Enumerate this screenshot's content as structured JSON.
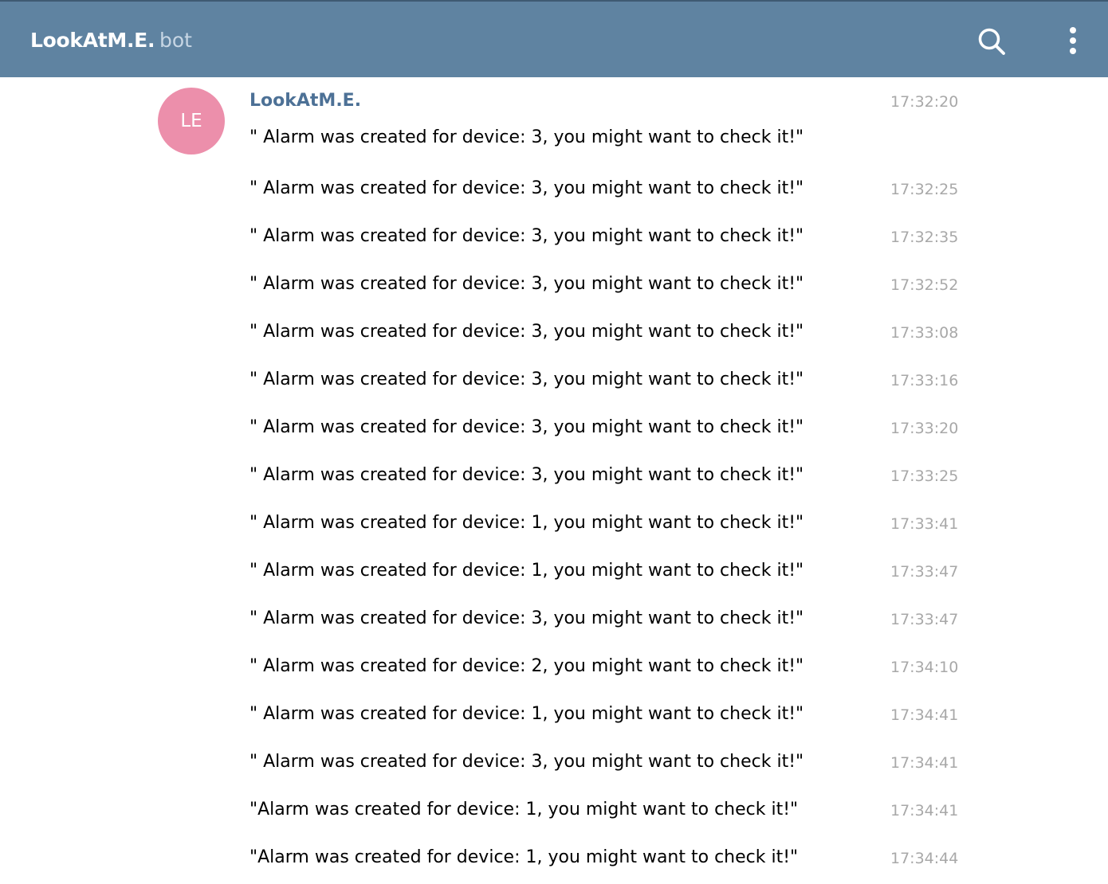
{
  "header": {
    "title": "LookAtM.E.",
    "subtitle": "bot",
    "search_icon": "search-icon",
    "menu_icon": "more-vertical-icon"
  },
  "conversation": {
    "avatar_initials": "LE",
    "avatar_color": "#ec8fab",
    "sender_name": "LookAtM.E.",
    "first_time": "17:32:20",
    "messages": [
      {
        "text": "\" Alarm was created for device: 3, you might want to check it!\"",
        "time": "17:32:20"
      },
      {
        "text": "\" Alarm was created for device: 3, you might want to check it!\"",
        "time": "17:32:25"
      },
      {
        "text": "\" Alarm was created for device: 3, you might want to check it!\"",
        "time": "17:32:35"
      },
      {
        "text": "\" Alarm was created for device: 3, you might want to check it!\"",
        "time": "17:32:52"
      },
      {
        "text": "\" Alarm was created for device: 3, you might want to check it!\"",
        "time": "17:33:08"
      },
      {
        "text": "\" Alarm was created for device: 3, you might want to check it!\"",
        "time": "17:33:16"
      },
      {
        "text": "\" Alarm was created for device: 3, you might want to check it!\"",
        "time": "17:33:20"
      },
      {
        "text": "\" Alarm was created for device: 3, you might want to check it!\"",
        "time": "17:33:25"
      },
      {
        "text": "\" Alarm was created for device: 1, you might want to check it!\"",
        "time": "17:33:41"
      },
      {
        "text": "\" Alarm was created for device: 1, you might want to check it!\"",
        "time": "17:33:47"
      },
      {
        "text": "\" Alarm was created for device: 3, you might want to check it!\"",
        "time": "17:33:47"
      },
      {
        "text": "\" Alarm was created for device: 2, you might want to check it!\"",
        "time": "17:34:10"
      },
      {
        "text": "\" Alarm was created for device: 1, you might want to check it!\"",
        "time": "17:34:41"
      },
      {
        "text": "\" Alarm was created for device: 3, you might want to check it!\"",
        "time": "17:34:41"
      },
      {
        "text": "\"Alarm was created for device: 1, you might want to check it!\"",
        "time": "17:34:41"
      },
      {
        "text": "\"Alarm was created for device: 1, you might want to check it!\"",
        "time": "17:34:44"
      }
    ]
  }
}
